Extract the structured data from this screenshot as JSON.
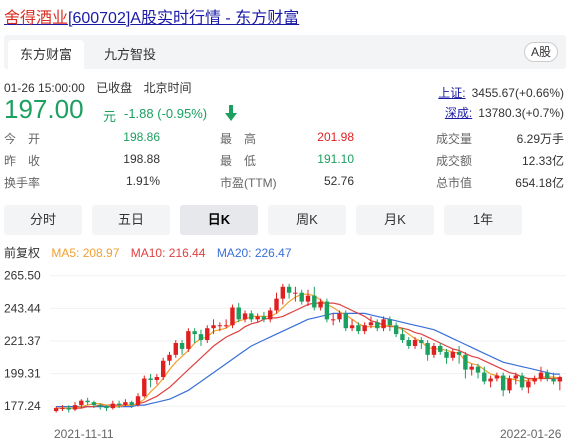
{
  "title": {
    "name": "舍得酒业",
    "code": "[600702]",
    "suffix": "A股实时行情 - 东方财富"
  },
  "tabs": {
    "tab1": "东方财富",
    "tab2": "九方智投",
    "market_badge": "A股"
  },
  "status": {
    "datetime": "01-26 15:00:00",
    "state": "已收盘",
    "tz": "北京时间"
  },
  "quote": {
    "price": "197.00",
    "unit": "元",
    "change": "-1.88 (-0.95%)"
  },
  "indices": [
    {
      "name": "上证:",
      "value": "3455.67(+0.66%)"
    },
    {
      "name": "深成:",
      "value": "13780.3(+0.7%)"
    }
  ],
  "stats": {
    "open_label": "今　开",
    "open": "198.86",
    "prev_label": "昨　收",
    "prev": "198.88",
    "turnover_label": "换手率",
    "turnover": "1.91%",
    "high_label": "最　高",
    "high": "201.98",
    "low_label": "最　低",
    "low": "191.10",
    "pe_label": "市盈(TTM)",
    "pe": "52.76",
    "volume_label": "成交量",
    "volume": "6.29万手",
    "amount_label": "成交额",
    "amount": "12.33亿",
    "cap_label": "总市值",
    "cap": "654.18亿"
  },
  "colors": {
    "up": "#e02020",
    "down": "#1ba05f",
    "ma5": "#f0a030",
    "ma10": "#e04040",
    "ma20": "#3a6fd8",
    "link": "#1a1aa6"
  },
  "periods": [
    "分时",
    "五日",
    "日K",
    "周K",
    "月K",
    "1年"
  ],
  "active_period": "日K",
  "legend": {
    "adjust": "前复权",
    "ma5": "MA5: 208.97",
    "ma10": "MA10: 216.44",
    "ma20": "MA20: 226.47"
  },
  "chart_data": {
    "type": "candlestick",
    "y_ticks": [
      "265.50",
      "243.44",
      "221.37",
      "199.31",
      "177.24"
    ],
    "ylim": [
      172,
      268
    ],
    "x_ticks": [
      "2021-11-11",
      "2022-01-26"
    ],
    "candles": [
      [
        174,
        176,
        173,
        177
      ],
      [
        176,
        176,
        174,
        178
      ],
      [
        176,
        175,
        173,
        178
      ],
      [
        175,
        178,
        174,
        180
      ],
      [
        178,
        181,
        176,
        182
      ],
      [
        181,
        180,
        178,
        183
      ],
      [
        180,
        178,
        176,
        181
      ],
      [
        178,
        177,
        175,
        179
      ],
      [
        177,
        176,
        174,
        178
      ],
      [
        176,
        179,
        175,
        181
      ],
      [
        179,
        178,
        176,
        181
      ],
      [
        178,
        180,
        177,
        182
      ],
      [
        180,
        178,
        176,
        181
      ],
      [
        178,
        184,
        177,
        186
      ],
      [
        184,
        196,
        183,
        198
      ],
      [
        196,
        195,
        190,
        199
      ],
      [
        195,
        197,
        192,
        199
      ],
      [
        197,
        208,
        195,
        210
      ],
      [
        208,
        212,
        205,
        214
      ],
      [
        212,
        220,
        210,
        222
      ],
      [
        220,
        216,
        212,
        222
      ],
      [
        216,
        228,
        214,
        230
      ],
      [
        228,
        226,
        220,
        230
      ],
      [
        226,
        222,
        218,
        229
      ],
      [
        222,
        230,
        220,
        232
      ],
      [
        230,
        232,
        226,
        236
      ],
      [
        232,
        232,
        228,
        234
      ],
      [
        232,
        232,
        230,
        236
      ],
      [
        232,
        244,
        230,
        246
      ],
      [
        244,
        236,
        234,
        247
      ],
      [
        236,
        240,
        234,
        242
      ],
      [
        240,
        236,
        234,
        242
      ],
      [
        236,
        238,
        234,
        240
      ],
      [
        238,
        236,
        234,
        241
      ],
      [
        236,
        242,
        234,
        244
      ],
      [
        242,
        250,
        240,
        254
      ],
      [
        250,
        258,
        246,
        260
      ],
      [
        258,
        254,
        250,
        260
      ],
      [
        254,
        254,
        248,
        258
      ],
      [
        254,
        248,
        246,
        256
      ],
      [
        248,
        252,
        245,
        256
      ],
      [
        252,
        244,
        242,
        258
      ],
      [
        244,
        248,
        242,
        250
      ],
      [
        248,
        236,
        234,
        250
      ],
      [
        236,
        236,
        232,
        240
      ],
      [
        236,
        240,
        234,
        242
      ],
      [
        240,
        230,
        228,
        242
      ],
      [
        230,
        232,
        228,
        236
      ],
      [
        232,
        228,
        226,
        234
      ],
      [
        228,
        232,
        226,
        234
      ],
      [
        232,
        234,
        230,
        238
      ],
      [
        234,
        230,
        228,
        236
      ],
      [
        230,
        236,
        228,
        238
      ],
      [
        236,
        232,
        228,
        238
      ],
      [
        232,
        226,
        224,
        234
      ],
      [
        226,
        222,
        220,
        230
      ],
      [
        222,
        218,
        216,
        224
      ],
      [
        218,
        222,
        216,
        224
      ],
      [
        222,
        220,
        216,
        224
      ],
      [
        220,
        212,
        208,
        222
      ],
      [
        212,
        218,
        210,
        220
      ],
      [
        218,
        214,
        212,
        220
      ],
      [
        214,
        210,
        206,
        216
      ],
      [
        210,
        214,
        208,
        216
      ],
      [
        214,
        212,
        206,
        218
      ],
      [
        212,
        202,
        196,
        214
      ],
      [
        202,
        204,
        198,
        206
      ],
      [
        204,
        200,
        196,
        206
      ],
      [
        200,
        194,
        192,
        204
      ],
      [
        194,
        196,
        190,
        198
      ],
      [
        196,
        198,
        194,
        200
      ],
      [
        198,
        188,
        184,
        200
      ],
      [
        188,
        196,
        186,
        198
      ],
      [
        196,
        198,
        192,
        200
      ],
      [
        198,
        190,
        188,
        200
      ],
      [
        190,
        194,
        186,
        196
      ],
      [
        194,
        196,
        192,
        198
      ],
      [
        196,
        200,
        194,
        204
      ],
      [
        200,
        196,
        194,
        202
      ],
      [
        196,
        194,
        192,
        200
      ],
      [
        194,
        197,
        188,
        198
      ]
    ],
    "ma5": [
      176,
      176,
      176,
      176,
      177,
      178,
      179,
      179,
      178,
      177,
      177,
      178,
      178,
      179,
      182,
      187,
      191,
      196,
      202,
      207,
      211,
      215,
      220,
      223,
      224,
      228,
      229,
      230,
      233,
      235,
      236,
      238,
      238,
      238,
      238,
      240,
      244,
      248,
      251,
      253,
      253,
      252,
      249,
      246,
      244,
      241,
      239,
      236,
      233,
      231,
      231,
      231,
      231,
      232,
      231,
      229,
      226,
      223,
      221,
      217,
      216,
      216,
      215,
      214,
      213,
      208,
      206,
      205,
      202,
      199,
      198,
      196,
      196,
      195,
      194,
      195,
      195,
      197,
      197,
      197,
      196
    ],
    "ma10": [
      176,
      176,
      176,
      176,
      176,
      177,
      177,
      178,
      178,
      178,
      178,
      178,
      178,
      179,
      180,
      182,
      184,
      187,
      190,
      194,
      198,
      202,
      206,
      210,
      214,
      218,
      221,
      224,
      226,
      228,
      231,
      233,
      234,
      236,
      237,
      237,
      238,
      240,
      242,
      244,
      246,
      247,
      247,
      247,
      247,
      246,
      244,
      242,
      240,
      238,
      235,
      234,
      232,
      231,
      231,
      230,
      229,
      227,
      226,
      224,
      222,
      220,
      218,
      216,
      215,
      213,
      211,
      210,
      208,
      206,
      204,
      202,
      200,
      199,
      197,
      196,
      196,
      196,
      196,
      196,
      196
    ],
    "ma20": [
      177,
      177,
      177,
      177,
      177,
      177,
      177,
      177,
      177,
      177,
      177,
      177,
      177,
      178,
      178,
      179,
      180,
      181,
      182,
      184,
      186,
      188,
      191,
      194,
      197,
      200,
      203,
      206,
      209,
      212,
      215,
      218,
      220,
      222,
      224,
      226,
      228,
      230,
      232,
      234,
      236,
      237,
      238,
      239,
      240,
      240,
      240,
      240,
      240,
      240,
      239,
      238,
      237,
      236,
      235,
      234,
      233,
      232,
      231,
      230,
      229,
      227,
      225,
      223,
      221,
      219,
      217,
      215,
      213,
      211,
      209,
      207,
      206,
      205,
      204,
      203,
      202,
      201,
      200,
      199,
      199
    ]
  }
}
